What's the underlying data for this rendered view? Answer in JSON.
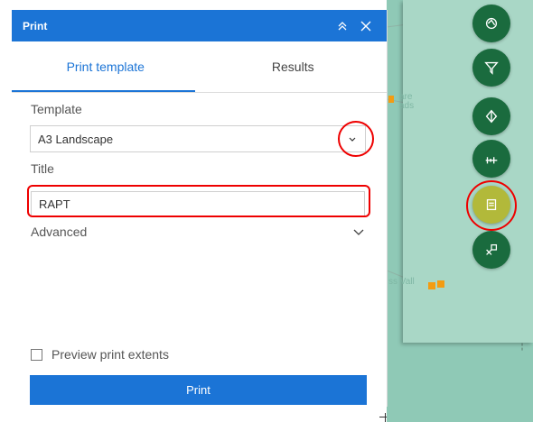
{
  "panel": {
    "title": "Print",
    "tabs": [
      {
        "label": "Print template"
      },
      {
        "label": "Results"
      }
    ],
    "template_label": "Template",
    "template_value": "A3 Landscape",
    "title_label": "Title",
    "title_value": "RAPT",
    "advanced_label": "Advanced",
    "preview_label": "Preview print extents",
    "print_button": "Print"
  },
  "map": {
    "labels": [
      "are",
      "ads",
      "ss Vall"
    ]
  },
  "toolbar": {
    "icons": [
      "legend-icon",
      "filter-icon",
      "layers-icon",
      "measure-icon",
      "print-icon",
      "query-icon"
    ]
  },
  "colors": {
    "header": "#1b74d6",
    "tool": "#1a6b3e",
    "tool_active": "#b2b93a",
    "map": "#a9d7c6",
    "annotation": "#e00000"
  }
}
